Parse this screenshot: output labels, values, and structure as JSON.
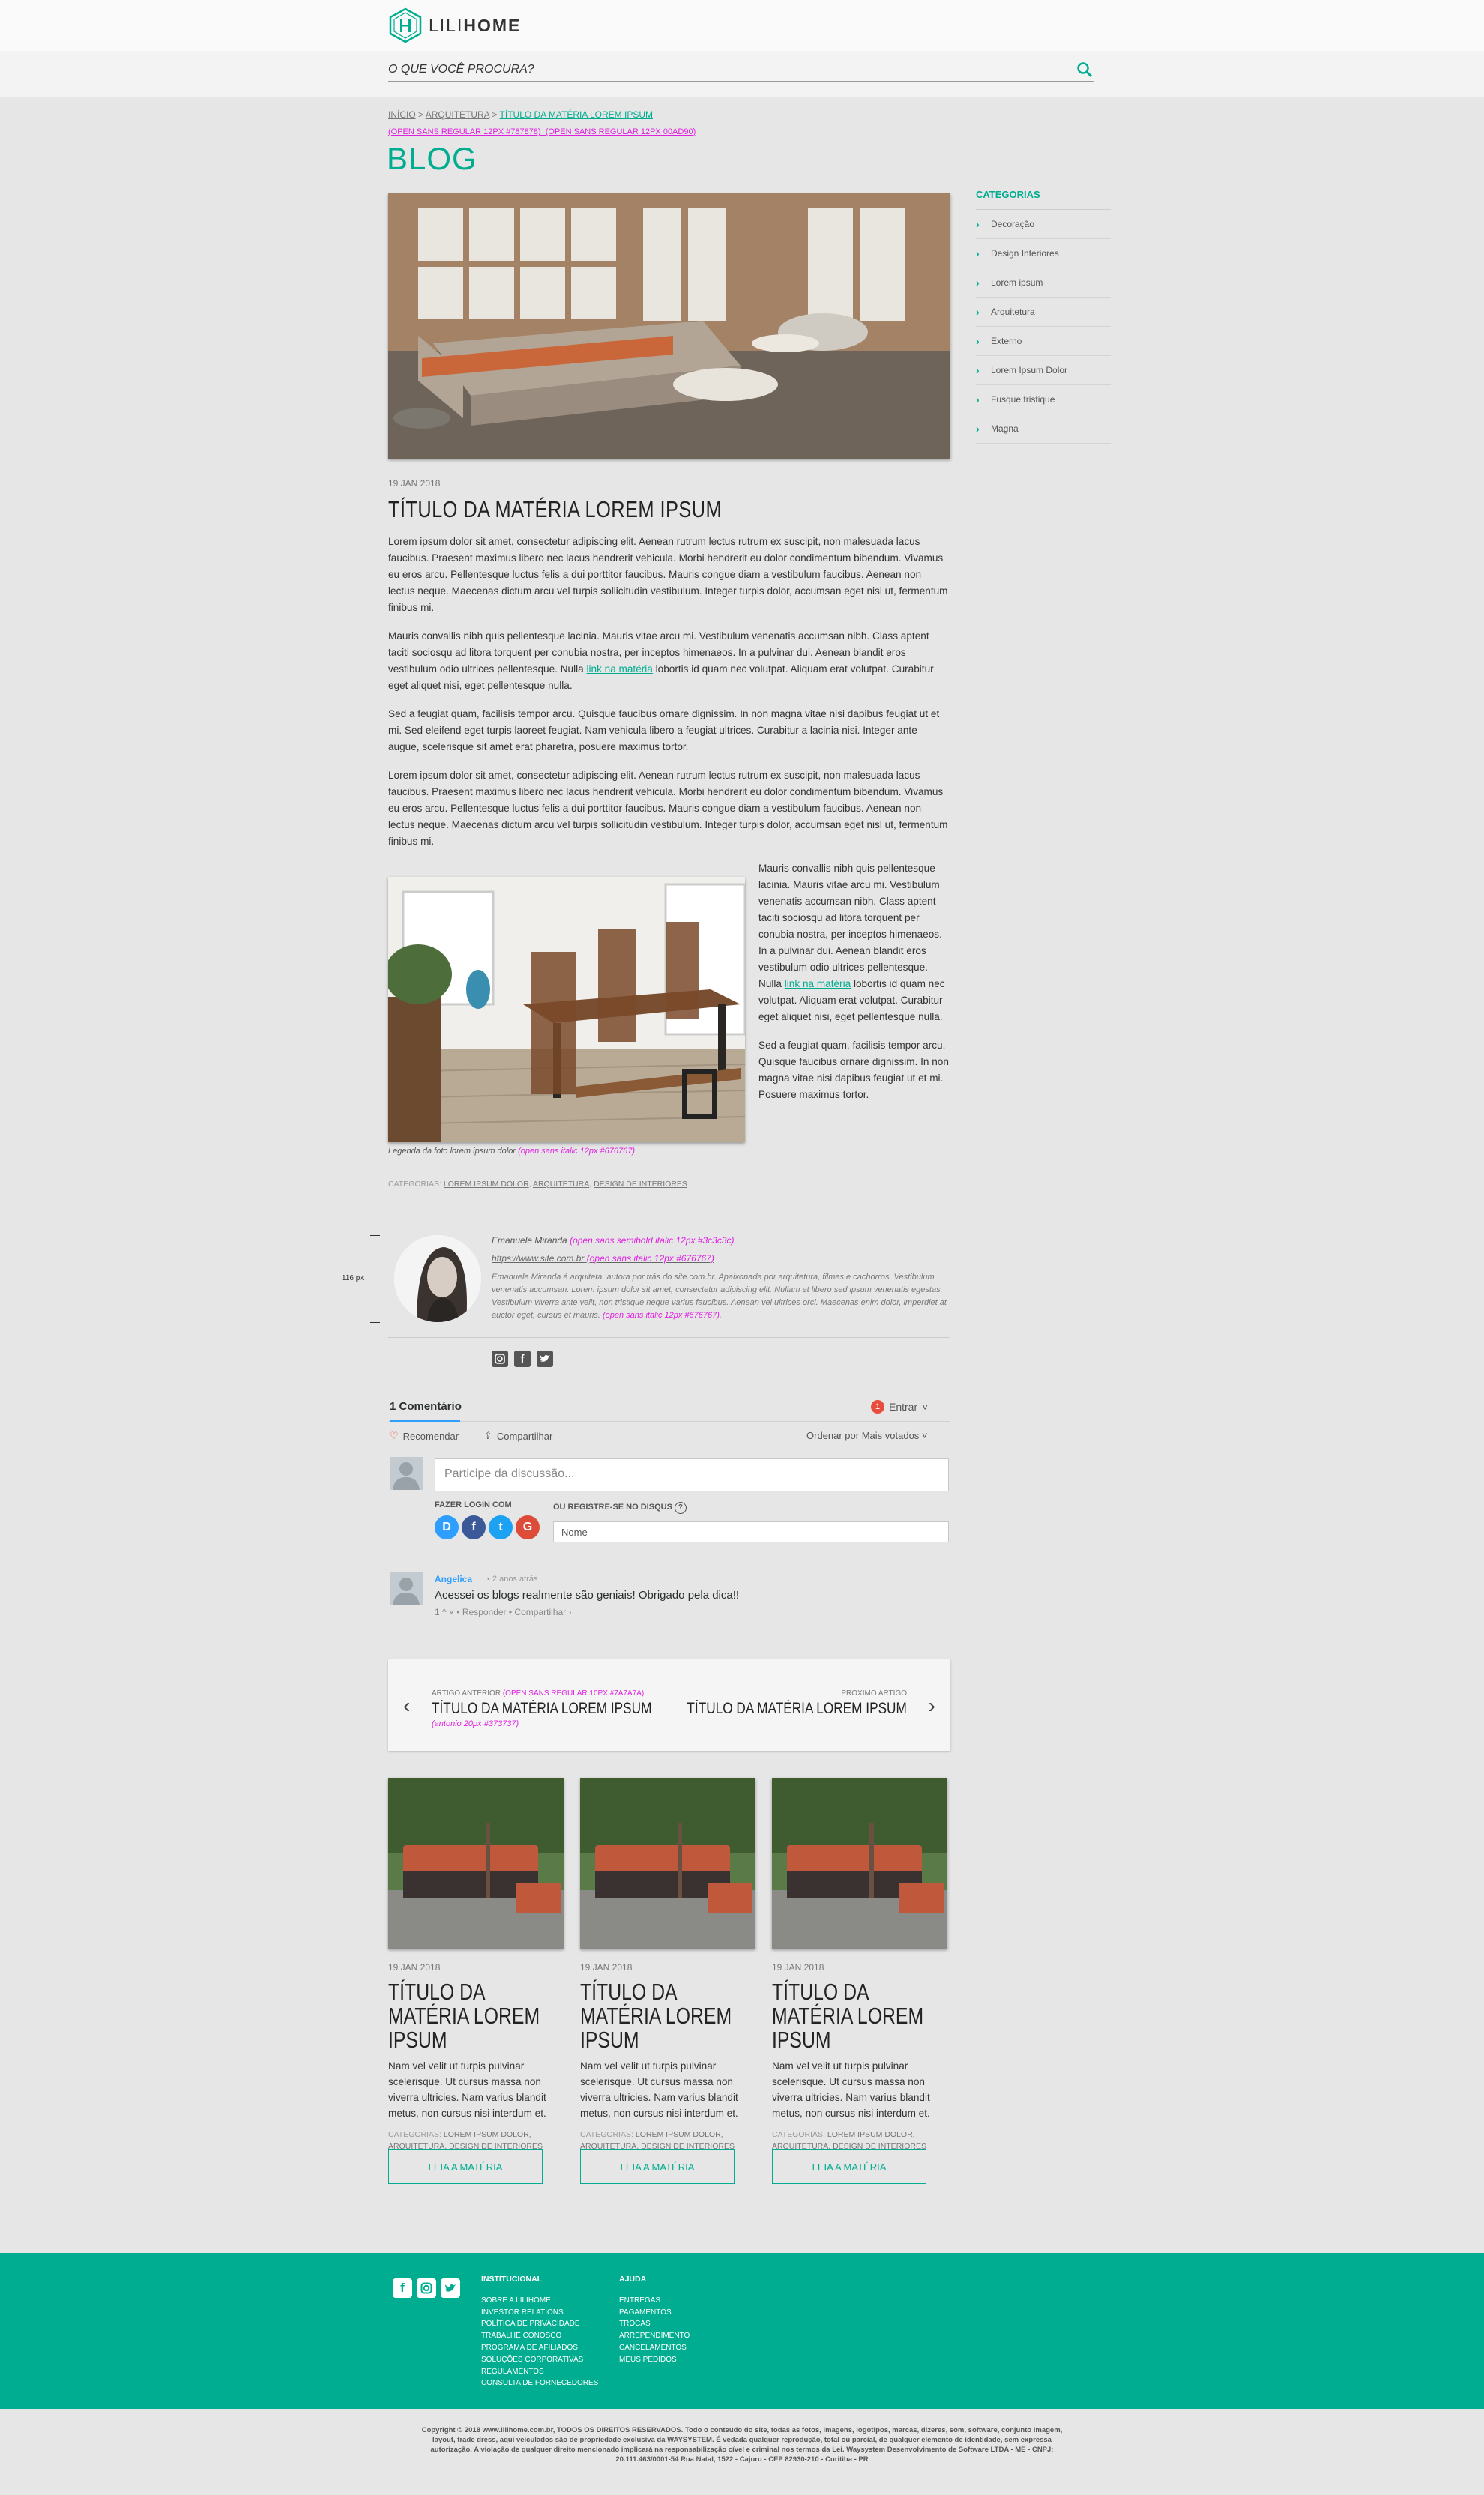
{
  "header": {
    "logo_brand_light": "LILI",
    "logo_brand_bold": "HOME",
    "search_placeholder": "O QUE VOCÊ PROCURA?"
  },
  "breadcrumb": {
    "items": [
      "INÍCIO",
      "ARQUITETURA",
      "TÍTULO DA MATÉRIA LOREM IPSUM"
    ],
    "separator": ">",
    "spec_gray": "(OPEN SANS REGULAR 12PX #787878)",
    "spec_green": "(OPEN SANS REGULAR 12PX 00AD90)"
  },
  "page_title": "BLOG",
  "sidebar": {
    "heading": "CATEGORIAS",
    "items": [
      "Decoração",
      "Design Interiores",
      "Lorem ipsum",
      "Arquitetura",
      "Externo",
      "Lorem Ipsum Dolor",
      "Fusque tristique",
      "Magna"
    ]
  },
  "article": {
    "date": "19 JAN 2018",
    "title": "TÍTULO DA MATÉRIA LOREM IPSUM",
    "p1": "Lorem ipsum dolor sit amet, consectetur adipiscing elit. Aenean rutrum lectus rutrum ex suscipit, non malesuada lacus faucibus. Praesent maximus libero nec lacus hendrerit vehicula. Morbi hendrerit eu dolor condimentum bibendum. Vivamus eu eros arcu. Pellentesque luctus felis a dui porttitor faucibus. Mauris congue diam a vestibulum faucibus. Aenean non lectus neque. Maecenas dictum arcu vel turpis sollicitudin vestibulum. Integer turpis dolor, accumsan eget nisl ut, fermentum finibus mi.",
    "p2_before": "Mauris convallis nibh quis pellentesque lacinia. Mauris vitae arcu mi. Vestibulum venenatis accumsan nibh. Class aptent taciti sociosqu ad litora torquent per conubia nostra, per inceptos himenaeos. In a pulvinar dui. Aenean blandit eros vestibulum odio ultrices pellentesque. Nulla ",
    "p2_link": "link na matéria",
    "p2_after": " lobortis id quam nec volutpat. Aliquam erat volutpat. Curabitur eget aliquet nisi, eget pellentesque nulla.",
    "p3": "Sed a feugiat quam, facilisis tempor arcu. Quisque faucibus ornare dignissim. In non magna vitae nisi dapibus feugiat ut et mi. Sed eleifend eget turpis laoreet feugiat. Nam vehicula libero a feugiat ultrices. Curabitur a lacinia nisi. Integer ante augue, scelerisque sit amet erat pharetra, posuere maximus tortor.",
    "p4": "Lorem ipsum dolor sit amet, consectetur adipiscing elit. Aenean rutrum lectus rutrum ex suscipit, non malesuada lacus faucibus. Praesent maximus libero nec lacus hendrerit vehicula. Morbi hendrerit eu dolor condimentum bibendum. Vivamus eu eros arcu. Pellentesque luctus felis a dui porttitor faucibus. Mauris congue diam a vestibulum faucibus. Aenean non lectus neque. Maecenas dictum arcu vel turpis sollicitudin vestibulum. Integer turpis dolor, accumsan eget nisl ut, fermentum finibus mi.",
    "wrap_p1_before": "Mauris convallis nibh quis pellentesque lacinia. Mauris vitae arcu mi. Vestibulum venenatis accumsan nibh. Class aptent taciti sociosqu ad litora torquent per conubia nostra, per inceptos himenaeos. In a pulvinar dui. Aenean blandit eros vestibulum odio ultrices pellentesque. Nulla ",
    "wrap_p1_link": "link na matéria",
    "wrap_p1_after": " lobortis id quam nec volutpat. Aliquam erat volutpat. Curabitur eget aliquet nisi, eget pellentesque nulla.",
    "wrap_p2": "Sed a feugiat quam, facilisis tempor arcu. Quisque faucibus ornare dignissim. In non magna vitae nisi dapibus feugiat ut et mi. Posuere maximus tortor.",
    "caption": "Legenda da foto lorem ipsum dolor",
    "caption_spec": "(open sans italic 12px #676767)",
    "categories_label": "CATEGORIAS:",
    "categories": [
      "LOREM IPSUM DOLOR",
      "ARQUITETURA",
      "DESIGN DE INTERIORES"
    ]
  },
  "author": {
    "ruler_label": "116 px",
    "name": "Emanuele Miranda",
    "name_spec": "(open sans semibold italic 12px #3c3c3c)",
    "site": "https://www.site.com.br",
    "site_spec": "(open sans italic 12px #676767)",
    "bio": "Emanuele Miranda é arquiteta, autora por trás do site.com.br. Apaixonada por arquitetura, filmes e cachorros. Vestibulum venenatis accumsan. Lorem ipsum dolor sit amet, consectetur adipiscing elit. Nullam et libero sed ipsum venenatis egestas. Vestibulum viverra ante velit, non tristique neque varius faucibus. Aenean vel ultrices orci. Maecenas enim dolor, imperdiet at auctor eget, cursus et mauris.",
    "bio_spec": "(open sans italic 12px #676767)."
  },
  "disqus": {
    "count_label": "1 Comentário",
    "login_badge": "1",
    "login_label": "Entrar",
    "recommend": "Recomendar",
    "share": "Compartilhar",
    "sort": "Ordenar por Mais votados",
    "input_placeholder": "Participe da discussão...",
    "login_with": "FAZER LOGIN COM",
    "register": "OU REGISTRE-SE NO DISQUS",
    "name_placeholder": "Nome",
    "comment": {
      "author": "Angelica",
      "time": "• 2 anos atrás",
      "text": "Acessei os blogs realmente são geniais! Obrigado pela dica!!",
      "actions": "1 ^  ˅  •  Responder  •  Compartilhar ›"
    }
  },
  "post_nav": {
    "prev_label": "ARTIGO ANTERIOR",
    "prev_label_spec": "(OPEN SANS REGULAR 10PX #7A7A7A)",
    "prev_title": "TÍTULO DA MATÉRIA LOREM IPSUM",
    "prev_spec": "(antonio 20px #373737)",
    "next_label": "PRÓXIMO ARTIGO",
    "next_title": "TÍTULO DA MATÉRIA LOREM IPSUM"
  },
  "related": [
    {
      "date": "19 JAN 2018",
      "title": "TÍTULO DA MATÉRIA LOREM IPSUM",
      "excerpt": "Nam vel velit ut turpis pulvinar scelerisque. Ut cursus massa non viverra ultricies. Nam varius blandit metus, non cursus nisi interdum et.",
      "cat_label": "CATEGORIAS:",
      "cat_1": "LOREM IPSUM DOLOR,",
      "cat_2": "ARQUITETURA,",
      "cat_3": "DESIGN DE INTERIORES",
      "button": "LEIA A MATÉRIA"
    },
    {
      "date": "19 JAN 2018",
      "title": "TÍTULO DA MATÉRIA LOREM IPSUM",
      "excerpt": "Nam vel velit ut turpis pulvinar scelerisque. Ut cursus massa non viverra ultricies. Nam varius blandit metus, non cursus nisi interdum et.",
      "cat_label": "CATEGORIAS:",
      "cat_1": "LOREM IPSUM DOLOR,",
      "cat_2": "ARQUITETURA,",
      "cat_3": "DESIGN DE INTERIORES",
      "button": "LEIA A MATÉRIA"
    },
    {
      "date": "19 JAN 2018",
      "title": "TÍTULO DA MATÉRIA LOREM IPSUM",
      "excerpt": "Nam vel velit ut turpis pulvinar scelerisque. Ut cursus massa non viverra ultricies. Nam varius blandit metus, non cursus nisi interdum et.",
      "cat_label": "CATEGORIAS:",
      "cat_1": "LOREM IPSUM DOLOR,",
      "cat_2": "ARQUITETURA,",
      "cat_3": "DESIGN DE INTERIORES",
      "button": "LEIA A MATÉRIA"
    }
  ],
  "footer": {
    "col1_heading": "INSTITUCIONAL",
    "col1_links": [
      "SOBRE A LILIHOME",
      "INVESTOR RELATIONS",
      "POLÍTICA DE PRIVACIDADE",
      "TRABALHE CONOSCO",
      "PROGRAMA DE AFILIADOS",
      "SOLUÇÕES CORPORATIVAS",
      "REGULAMENTOS",
      "CONSULTA DE FORNECEDORES"
    ],
    "col2_heading": "AJUDA",
    "col2_links": [
      "ENTREGAS",
      "PAGAMENTOS",
      "TROCAS",
      "ARREPENDIMENTO",
      "CANCELAMENTOS",
      "MEUS PEDIDOS"
    ],
    "copyright_1": "Copyright © 2018 www.lilihome.com.br, TODOS OS DIREITOS RESERVADOS. Todo o conteúdo do site, todas as fotos, imagens, logotipos, marcas, dizeres, som, software, conjunto imagem,",
    "copyright_2": "layout, trade dress, aqui veiculados são de propriedade exclusiva da WAYSYSTEM. É vedada qualquer reprodução, total ou parcial, de qualquer elemento de identidade, sem expressa",
    "copyright_3": "autorização. A violação de qualquer direito mencionado implicará na responsabilização cível e criminal nos termos da Lei. Waysystem Desenvolvimento de Software LTDA - ME - CNPJ:",
    "copyright_4": "20.111.463/0001-54 Rua Natal, 1522 - Cajuru - CEP 82930-210 - Curitiba - PR"
  },
  "colors": {
    "accent": "#00ad90",
    "spec_magenta": "#e020e0",
    "background": "#e6e6e6",
    "disqus_blue": "#2e9fff"
  }
}
